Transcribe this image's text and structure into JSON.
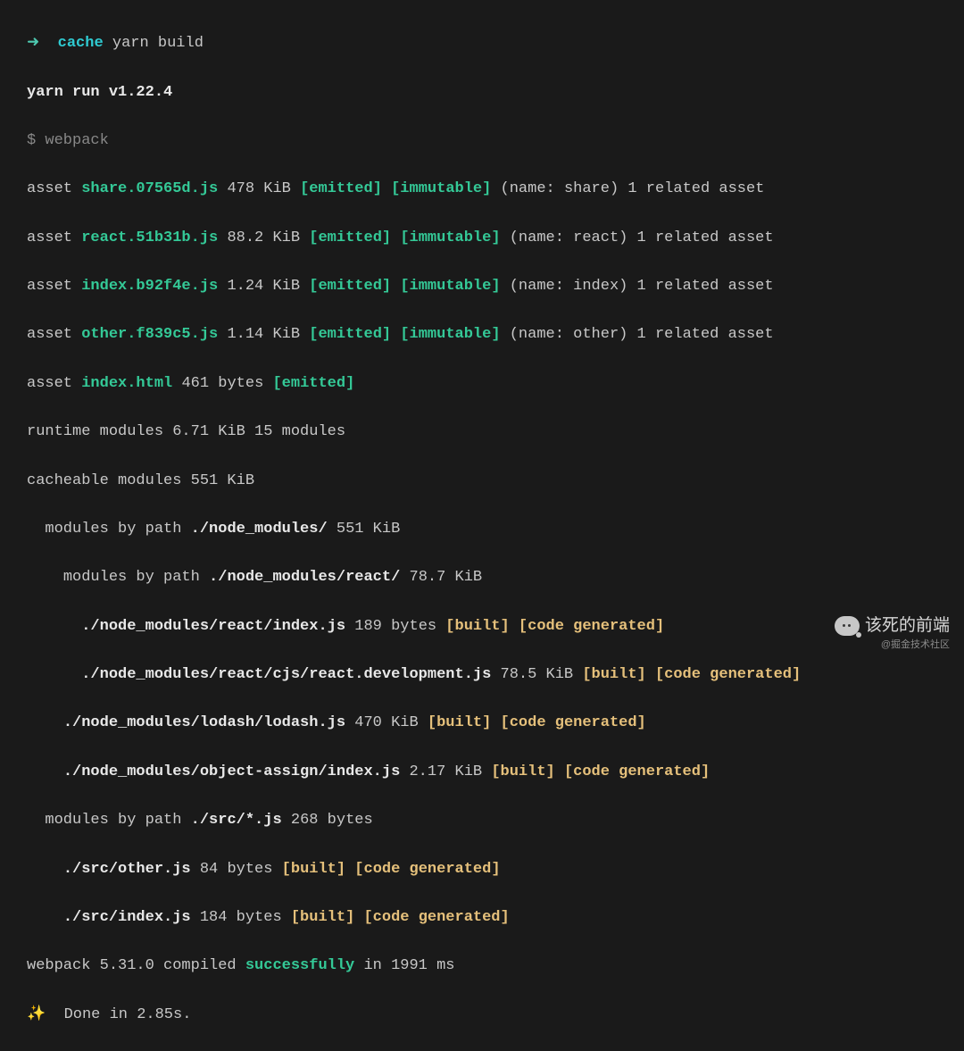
{
  "prompt": {
    "arrow": "➜",
    "context": "cache",
    "command": "yarn build"
  },
  "yarn": {
    "run_line": "yarn run v1.22.4",
    "dollar": "$",
    "task": "webpack"
  },
  "assets": [
    {
      "prefix": "asset ",
      "name": "share.07565d.js",
      "size": " 478 KiB ",
      "emitted": "[emitted]",
      "sp1": " ",
      "immutable": "[immutable]",
      "rest": " (name: share) 1 related asset"
    },
    {
      "prefix": "asset ",
      "name": "react.51b31b.js",
      "size": " 88.2 KiB ",
      "emitted": "[emitted]",
      "sp1": " ",
      "immutable": "[immutable]",
      "rest": " (name: react) 1 related asset"
    },
    {
      "prefix": "asset ",
      "name": "index.b92f4e.js",
      "size": " 1.24 KiB ",
      "emitted": "[emitted]",
      "sp1": " ",
      "immutable": "[immutable]",
      "rest": " (name: index) 1 related asset"
    },
    {
      "prefix": "asset ",
      "name": "other.f839c5.js",
      "size": " 1.14 KiB ",
      "emitted": "[emitted]",
      "sp1": " ",
      "immutable": "[immutable]",
      "rest": " (name: other) 1 related asset"
    }
  ],
  "html_asset": {
    "prefix": "asset ",
    "name": "index.html",
    "size": " 461 bytes ",
    "emitted": "[emitted]"
  },
  "layers": {
    "runtime": "runtime modules 6.71 KiB 15 modules",
    "cacheable": "cacheable modules 551 KiB",
    "indent2": "  modules by path ",
    "node_modules": "./node_modules/",
    "node_modules_size": " 551 KiB",
    "indent4": "    modules by path ",
    "react_path": "./node_modules/react/",
    "react_path_size": " 78.7 KiB",
    "indent6": "      ",
    "react_index": "./node_modules/react/index.js",
    "react_index_size": " 189 bytes ",
    "react_dev": "./node_modules/react/cjs/react.development.js",
    "react_dev_size": " 78.5 KiB ",
    "indent4b": "    ",
    "lodash": "./node_modules/lodash/lodash.js",
    "lodash_size": " 470 KiB ",
    "object_assign": "./node_modules/object-assign/index.js",
    "object_assign_size": " 2.17 KiB ",
    "src_path_prefix": "  modules by path ",
    "src_path": "./src/*.js",
    "src_path_size": " 268 bytes",
    "src_other": "./src/other.js",
    "src_other_size": " 84 bytes ",
    "src_index": "./src/index.js",
    "src_index_size": " 184 bytes "
  },
  "tags": {
    "built": "[built]",
    "code_generated": "[code generated]"
  },
  "compile": {
    "prefix": "webpack 5.31.0 compiled ",
    "status": "successfully",
    "suffix": " in 1991 ms"
  },
  "done": {
    "sparkle": "✨",
    "text": "  Done in 2.85s."
  },
  "watermark": {
    "text": "该死的前端",
    "sub": "@掘金技术社区"
  }
}
